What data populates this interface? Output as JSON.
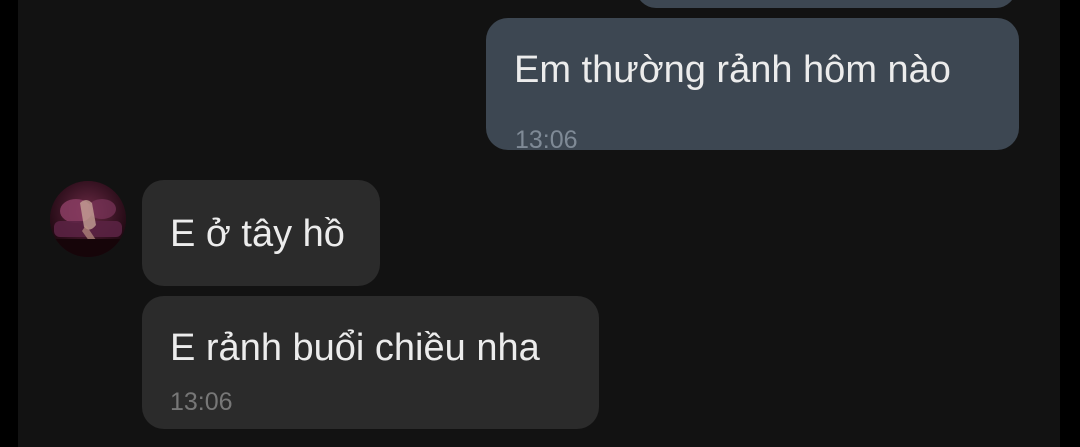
{
  "conversation": {
    "messages": [
      {
        "direction": "outgoing",
        "text": "Em thường rảnh hôm nào",
        "time": "13:06"
      },
      {
        "direction": "incoming",
        "text": "E ở tây hồ",
        "time": ""
      },
      {
        "direction": "incoming",
        "text": "E rảnh buổi chiều nha",
        "time": "13:06"
      }
    ],
    "contact": {
      "avatar_icon": "contact-avatar-photo"
    }
  },
  "colors": {
    "page_background": "#000000",
    "chat_background": "#121212",
    "outgoing_bubble": "#3d4752",
    "incoming_bubble": "#2b2b2b",
    "message_text": "#ececec",
    "outgoing_time": "#7f8a96",
    "incoming_time": "#777777"
  }
}
